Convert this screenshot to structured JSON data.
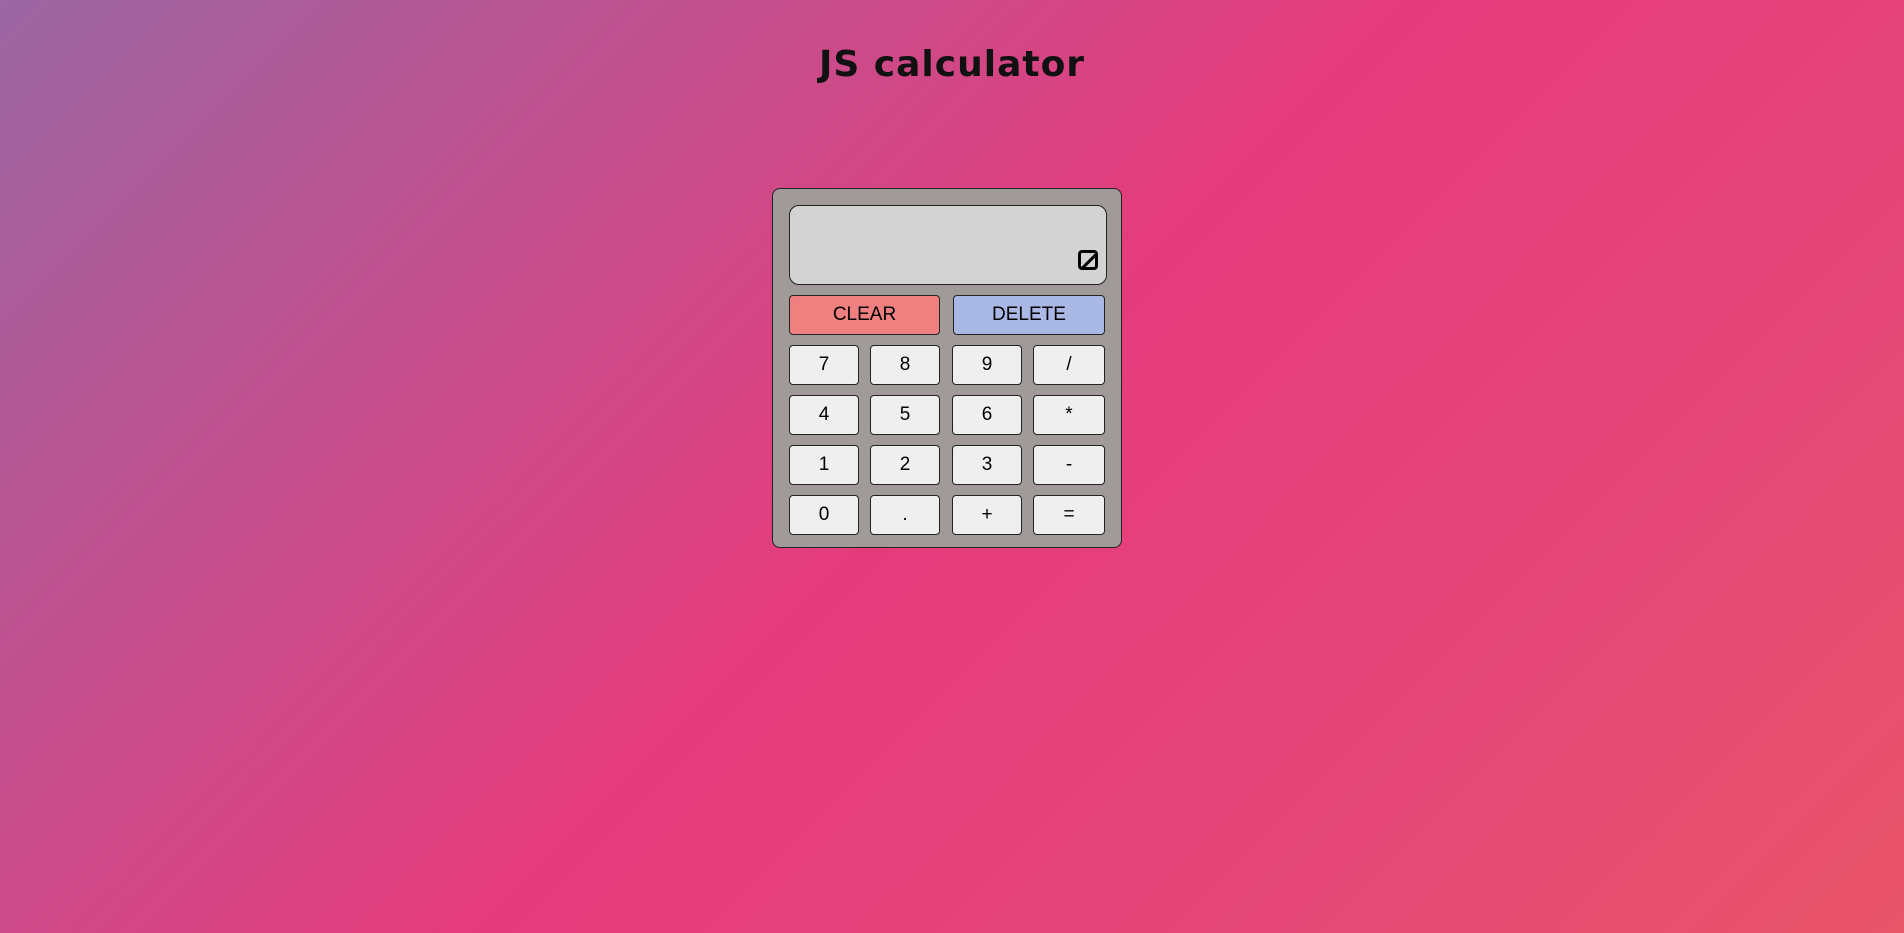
{
  "header": {
    "title": "JS calculator"
  },
  "display": {
    "value": ""
  },
  "controls": {
    "clear_label": "CLEAR",
    "delete_label": "DELETE"
  },
  "keys": {
    "row1": [
      "7",
      "8",
      "9",
      "/"
    ],
    "row2": [
      "4",
      "5",
      "6",
      "*"
    ],
    "row3": [
      "1",
      "2",
      "3",
      "-"
    ],
    "row4": [
      "0",
      ".",
      "+",
      "="
    ]
  },
  "colors": {
    "clear": "#f08080",
    "delete": "#aab8e6",
    "body": "#a09a99",
    "display": "#d3d3d3",
    "key": "#efefef"
  },
  "icons": {
    "display_corner": "resize-handle-icon"
  }
}
